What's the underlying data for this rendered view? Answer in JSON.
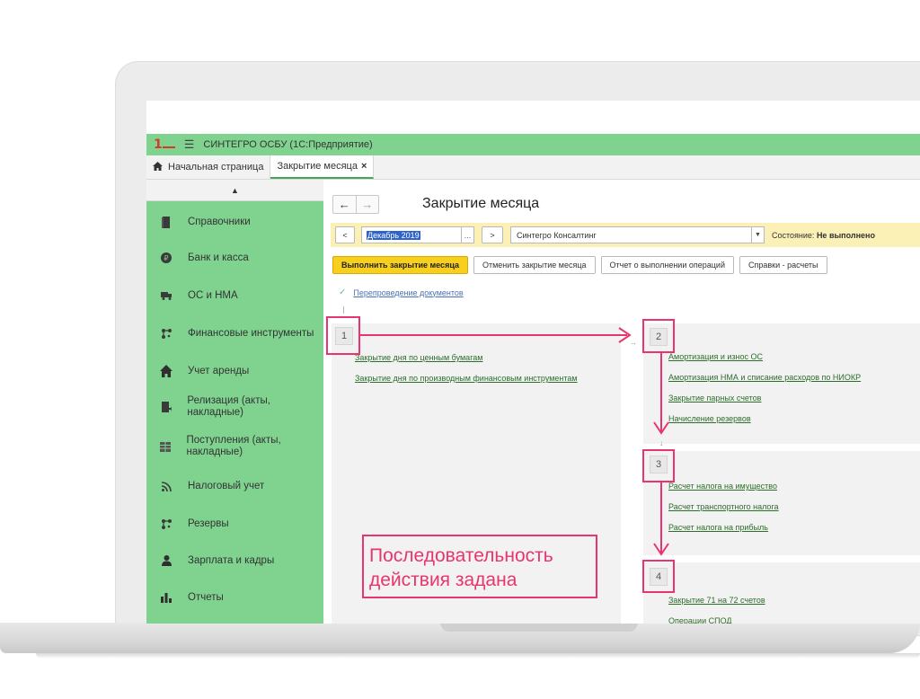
{
  "app": {
    "title": "СИНТЕГРО ОСБУ  (1С:Предприятие)"
  },
  "tabs": [
    {
      "label": "Начальная страница"
    },
    {
      "label": "Закрытие месяца"
    }
  ],
  "sidebar": {
    "items": [
      {
        "label": "Справочники",
        "icon": "book-icon"
      },
      {
        "label": "Банк и касса",
        "icon": "coin-icon"
      },
      {
        "label": "ОС и НМА",
        "icon": "truck-icon"
      },
      {
        "label": "Финансовые инструменты",
        "icon": "network-icon"
      },
      {
        "label": "Учет аренды",
        "icon": "house-icon"
      },
      {
        "label": "Релизация (акты, накладные)",
        "icon": "document-arrow-icon"
      },
      {
        "label": "Поступления (акты, накладные)",
        "icon": "table-icon"
      },
      {
        "label": "Налоговый учет",
        "icon": "feed-icon"
      },
      {
        "label": "Резервы",
        "icon": "network-icon"
      },
      {
        "label": "Зарплата и кадры",
        "icon": "person-icon"
      },
      {
        "label": "Отчеты",
        "icon": "bar-chart-icon"
      }
    ]
  },
  "form": {
    "title": "Закрытие месяца",
    "period": "Декабрь 2019",
    "organization": "Синтегро Консалтинг",
    "state_label": "Состояние:",
    "state_value": "Не выполнено",
    "prev_label": "<",
    "next_label": ">",
    "dots_label": "...",
    "buttons": {
      "run": "Выполнить закрытие месяца",
      "cancel": "Отменить закрытие месяца",
      "report": "Отчет о выполнении операций",
      "refs": "Справки - расчеты"
    },
    "repost": "Перепроведение документов"
  },
  "steps": [
    {
      "num": "1",
      "items": [
        "Закрытие дня по ценным бумагам",
        "Закрытие дня по производным финансовым инструментам"
      ]
    },
    {
      "num": "2",
      "items": [
        "Амортизация и износ ОС",
        "Амортизация НМА и списание расходов по НИОКР",
        "Закрытие парных счетов",
        "Начисление резервов"
      ]
    },
    {
      "num": "3",
      "items": [
        "Расчет налога на имущество",
        "Расчет транспортного налога",
        "Расчет налога на прибыль"
      ]
    },
    {
      "num": "4",
      "items": [
        "Закрытие 71 на 72 счетов",
        "Операции СПОД"
      ]
    }
  ],
  "callout": {
    "line1": "Последовательность",
    "line2": "действия задана"
  },
  "colors": {
    "accent_green": "#7fd38f",
    "annotation_pink": "#e8356d",
    "primary_yellow": "#f7cf1c",
    "param_bar": "#fbf0b6"
  }
}
